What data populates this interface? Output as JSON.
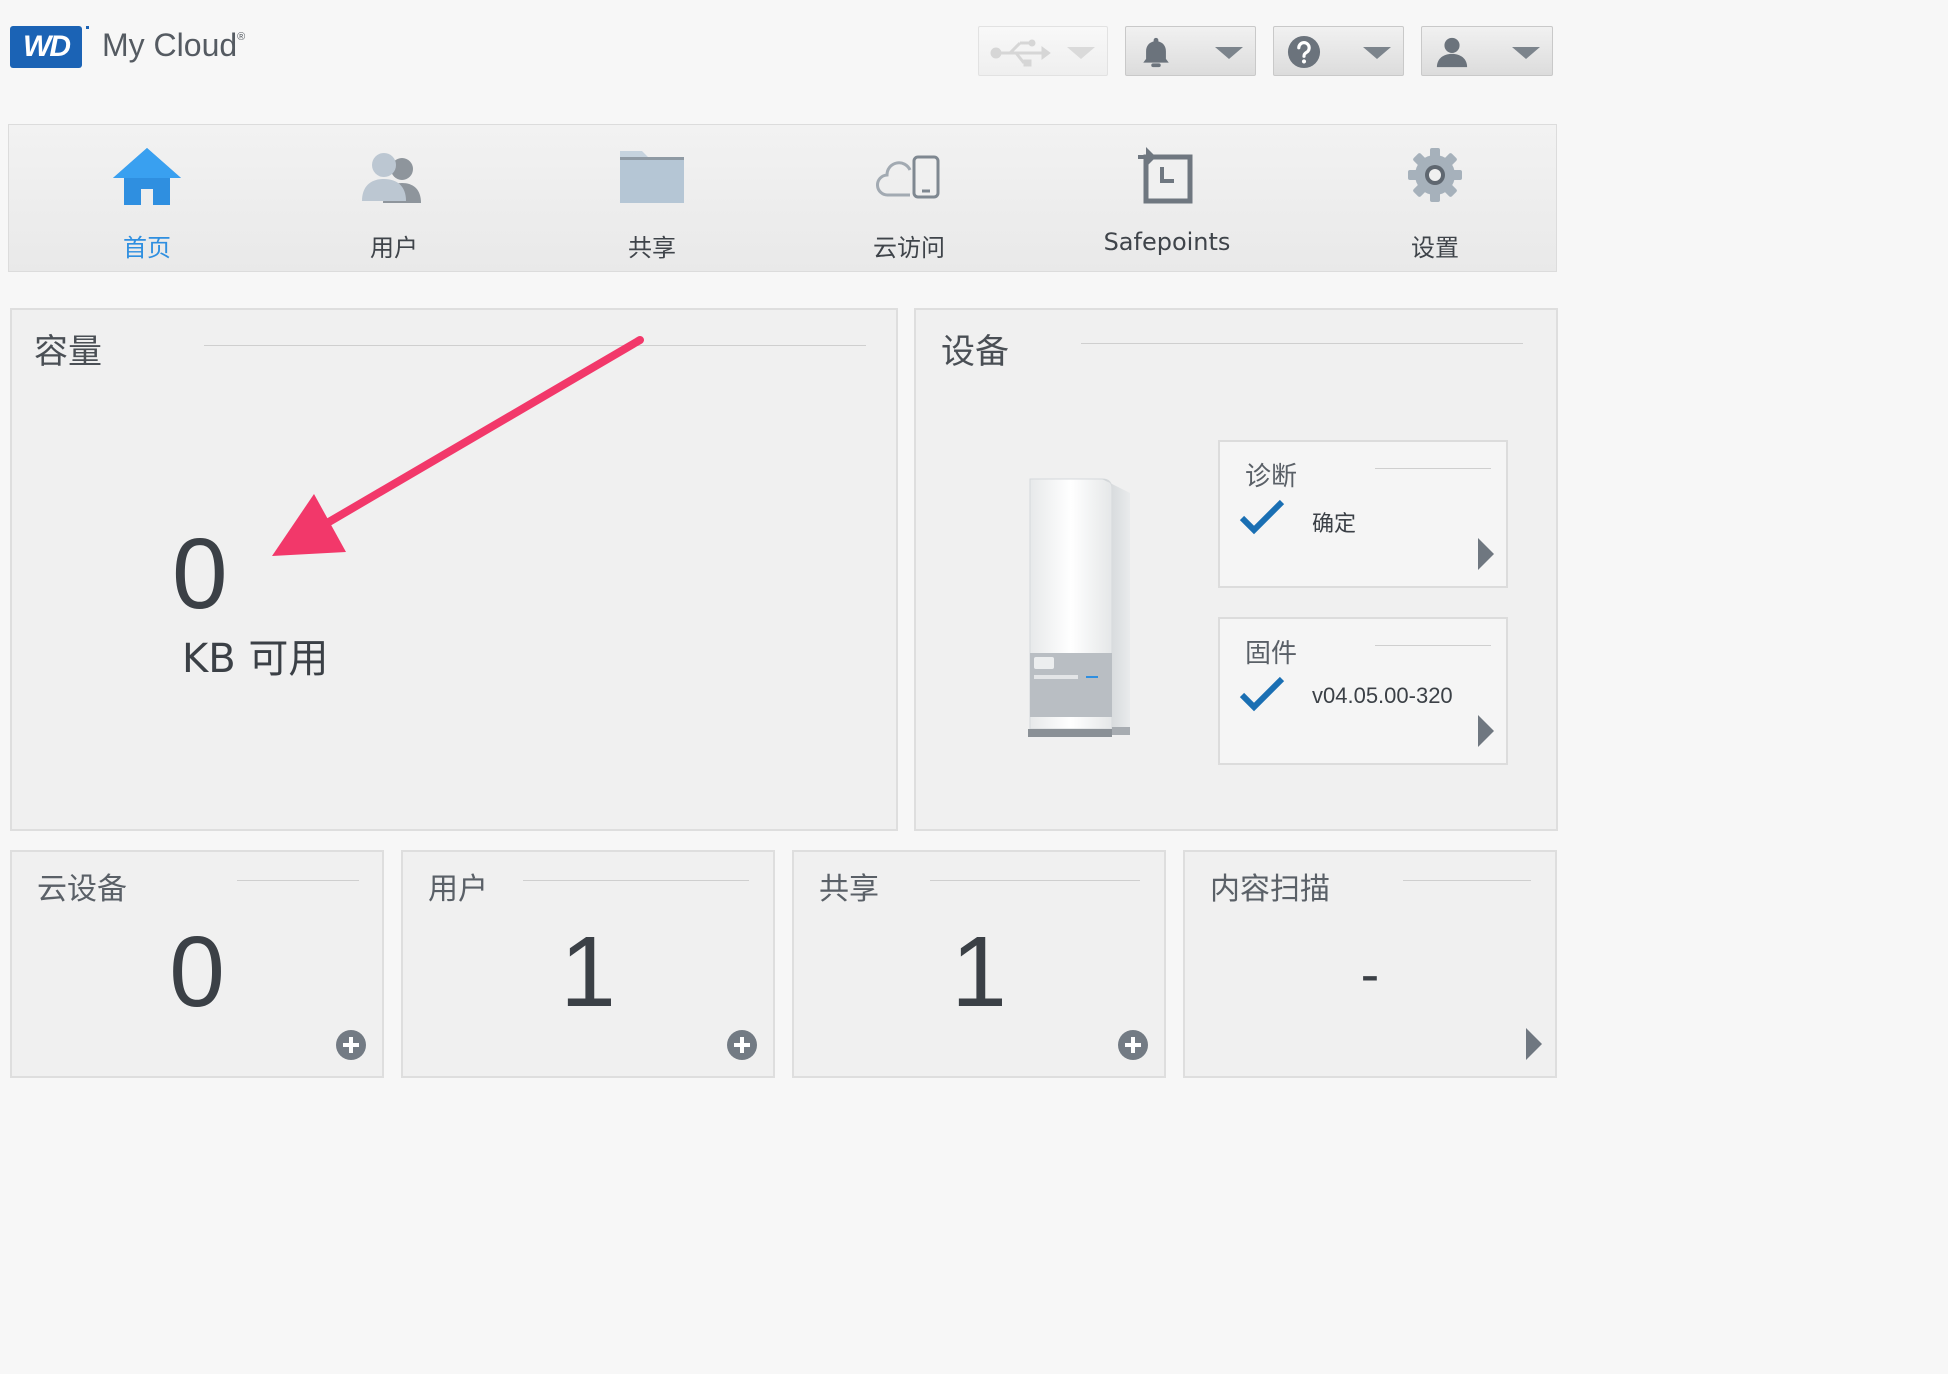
{
  "header": {
    "logo_text": "WD",
    "brand": "My Cloud",
    "brand_mark": "®",
    "buttons": [
      {
        "icon": "usb-icon",
        "disabled": true
      },
      {
        "icon": "bell-icon"
      },
      {
        "icon": "help-icon"
      },
      {
        "icon": "user-icon"
      }
    ]
  },
  "nav": {
    "items": [
      {
        "label": "首页",
        "icon": "home-icon",
        "active": true
      },
      {
        "label": "用户",
        "icon": "users-icon"
      },
      {
        "label": "共享",
        "icon": "folder-icon"
      },
      {
        "label": "云访问",
        "icon": "cloud-device-icon"
      },
      {
        "label": "Safepoints",
        "icon": "safepoints-icon"
      },
      {
        "label": "设置",
        "icon": "gear-icon"
      }
    ]
  },
  "capacity": {
    "title": "容量",
    "value": "0",
    "unit": "KB 可用"
  },
  "device": {
    "title": "设备",
    "cards": [
      {
        "title": "诊断",
        "value": "确定"
      },
      {
        "title": "固件",
        "value": "v04.05.00-320"
      }
    ]
  },
  "summary": [
    {
      "title": "云设备",
      "value": "0",
      "action": "plus"
    },
    {
      "title": "用户",
      "value": "1",
      "action": "plus"
    },
    {
      "title": "共享",
      "value": "1",
      "action": "plus"
    },
    {
      "title": "内容扫描",
      "value": "-",
      "action": "arrow"
    }
  ],
  "colors": {
    "brand_blue": "#1b63b5",
    "nav_active": "#2f8fe0",
    "check_blue": "#1a6fb3",
    "annotation_arrow": "#f2386a"
  }
}
